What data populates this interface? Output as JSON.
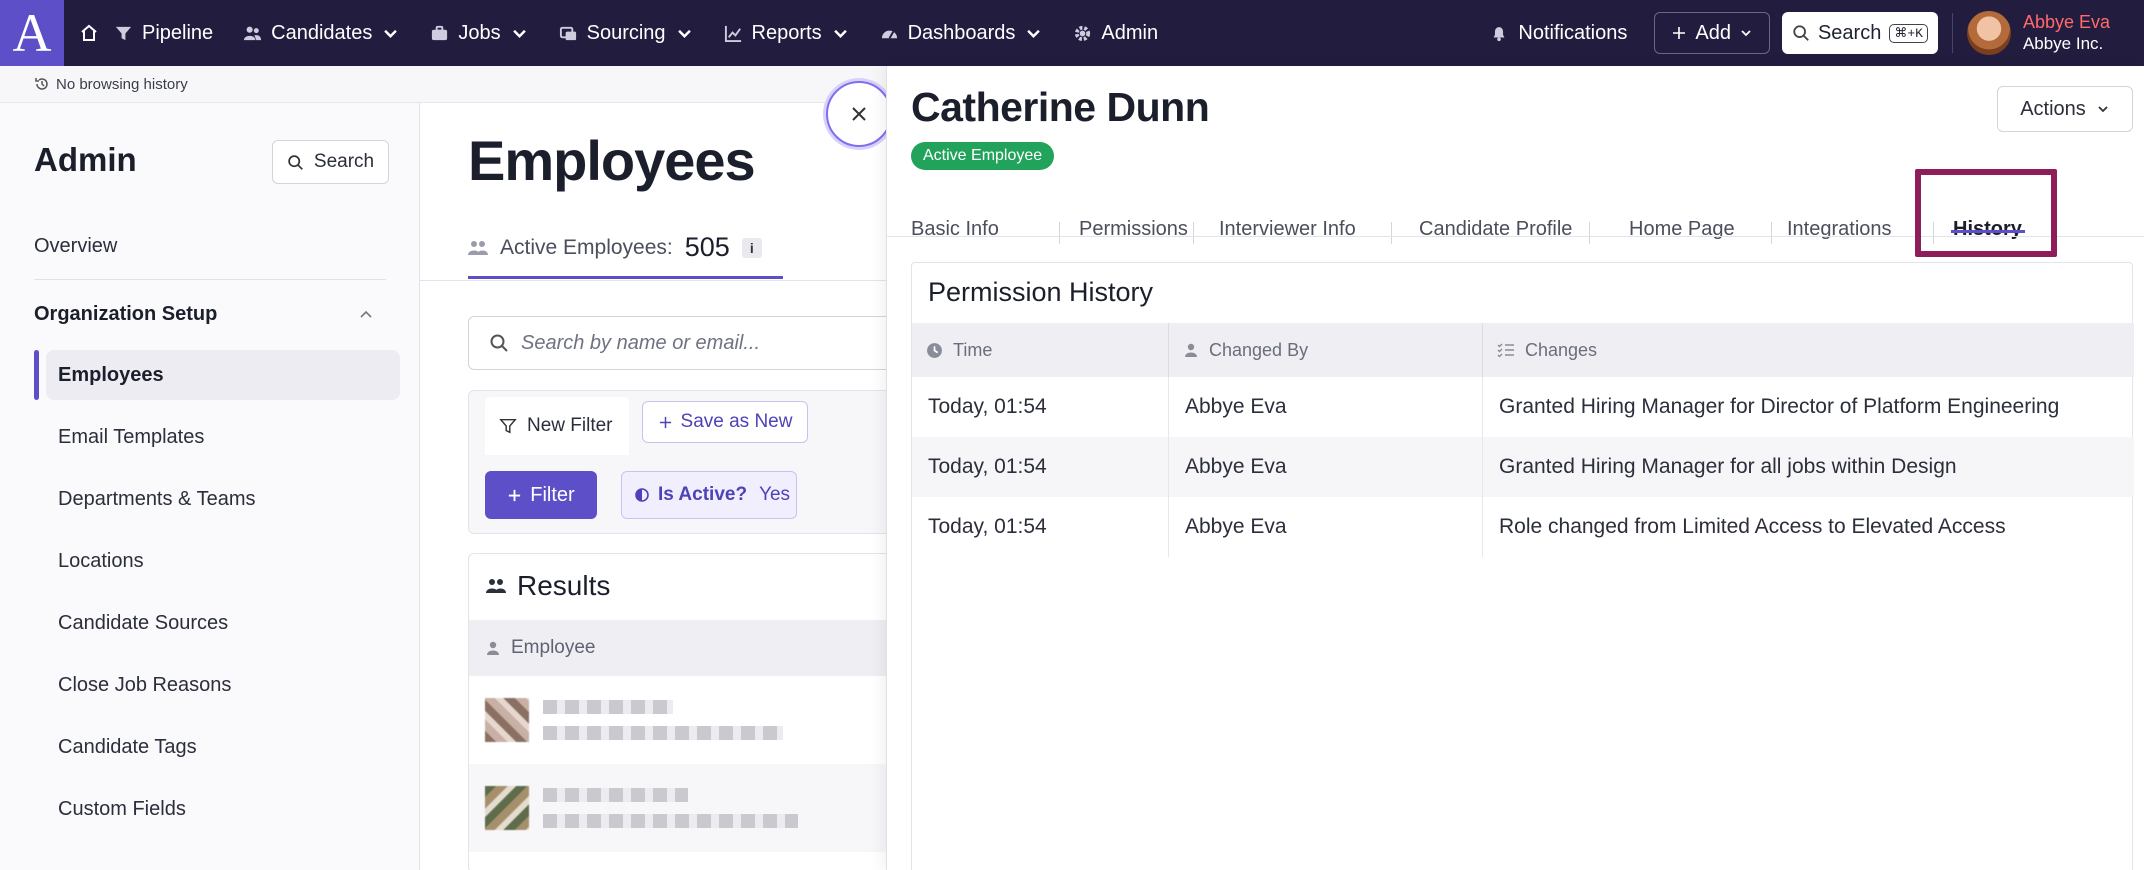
{
  "nav": {
    "logo": "A",
    "items": [
      {
        "label": "Pipeline",
        "icon": "funnel-icon",
        "dropdown": false
      },
      {
        "label": "Candidates",
        "icon": "people-icon",
        "dropdown": true
      },
      {
        "label": "Jobs",
        "icon": "briefcase-icon",
        "dropdown": true
      },
      {
        "label": "Sourcing",
        "icon": "sourcing-icon",
        "dropdown": true
      },
      {
        "label": "Reports",
        "icon": "chart-icon",
        "dropdown": true
      },
      {
        "label": "Dashboards",
        "icon": "gauge-icon",
        "dropdown": true
      },
      {
        "label": "Admin",
        "icon": "gear-icon",
        "dropdown": false
      }
    ],
    "notifications": "Notifications",
    "add": "Add",
    "search": "Search",
    "search_shortcut": "⌘+K",
    "user_name": "Abbye Eva",
    "user_org": "Abbye Inc."
  },
  "history_strip": "No browsing history",
  "sidebar": {
    "title": "Admin",
    "search": "Search",
    "overview": "Overview",
    "section": "Organization Setup",
    "items": [
      {
        "label": "Employees",
        "active": true
      },
      {
        "label": "Email Templates"
      },
      {
        "label": "Departments & Teams"
      },
      {
        "label": "Locations"
      },
      {
        "label": "Candidate Sources"
      },
      {
        "label": "Close Job Reasons"
      },
      {
        "label": "Candidate Tags"
      },
      {
        "label": "Custom Fields"
      }
    ]
  },
  "main": {
    "title": "Employees",
    "stat_label": "Active Employees:",
    "stat_value": "505",
    "info": "i",
    "search_placeholder": "Search by name or email...",
    "new_filter": "New Filter",
    "save_as_new": "Save as New",
    "filter": "Filter",
    "chip_label": "Is Active?",
    "chip_value": "Yes",
    "results_title": "Results",
    "results_col": "Employee"
  },
  "drawer": {
    "name": "Catherine Dunn",
    "badge": "Active Employee",
    "actions": "Actions",
    "tabs": [
      "Basic Info",
      "Permissions",
      "Interviewer Info",
      "Candidate Profile",
      "Home Page",
      "Integrations",
      "History"
    ],
    "active_tab": "History",
    "card_title": "Permission History",
    "columns": [
      "Time",
      "Changed By",
      "Changes"
    ],
    "rows": [
      {
        "time": "Today, 01:54",
        "by": "Abbye Eva",
        "change": "Granted Hiring Manager for Director of Platform Engineering"
      },
      {
        "time": "Today, 01:54",
        "by": "Abbye Eva",
        "change": "Granted Hiring Manager for all jobs within Design"
      },
      {
        "time": "Today, 01:54",
        "by": "Abbye Eva",
        "change": "Role changed from Limited Access to Elevated Access"
      }
    ]
  },
  "colors": {
    "nav_bg": "#221c3f",
    "accent": "#5c4fc7",
    "badge_green": "#21a35b",
    "highlight": "#8e1d5a",
    "user_name": "#ff6b6b"
  }
}
